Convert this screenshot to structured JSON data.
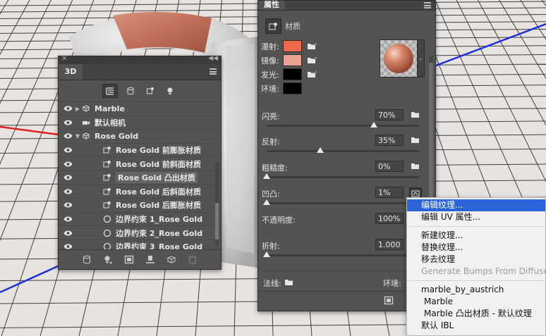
{
  "panel3d": {
    "tab": "3D",
    "filter_icons": [
      "scene-filter-icon",
      "mesh-filter-icon",
      "material-filter-icon",
      "light-filter-icon"
    ],
    "layers": [
      {
        "label": "Marble",
        "indent": 0,
        "expand": "▶",
        "icon": "mesh-icon",
        "bold": true,
        "selected": false
      },
      {
        "label": "默认相机",
        "indent": 0,
        "expand": "",
        "icon": "camera-icon",
        "bold": true,
        "selected": false
      },
      {
        "label": "Rose Gold",
        "indent": 0,
        "expand": "▼",
        "icon": "mesh-icon",
        "bold": true,
        "selected": false
      },
      {
        "label": "Rose Gold 前膨胀材质",
        "indent": 1,
        "expand": "",
        "icon": "material-icon",
        "bold": true,
        "selected": false
      },
      {
        "label": "Rose Gold 前斜面材质",
        "indent": 1,
        "expand": "",
        "icon": "material-icon",
        "bold": true,
        "selected": false
      },
      {
        "label": "Rose Gold 凸出材质",
        "indent": 1,
        "expand": "",
        "icon": "material-icon",
        "bold": true,
        "selected": true
      },
      {
        "label": "Rose Gold 后斜面材质",
        "indent": 1,
        "expand": "",
        "icon": "material-icon",
        "bold": true,
        "selected": false
      },
      {
        "label": "Rose Gold 后膨胀材质",
        "indent": 1,
        "expand": "",
        "icon": "material-icon",
        "bold": true,
        "selected": false
      },
      {
        "label": "边界约束 1_Rose Gold",
        "indent": 1,
        "expand": "",
        "icon": "constraint-icon",
        "bold": true,
        "selected": false
      },
      {
        "label": "边界约束 2_Rose Gold",
        "indent": 1,
        "expand": "",
        "icon": "constraint-icon",
        "bold": true,
        "selected": false
      },
      {
        "label": "边界约束 3_Rose Gold",
        "indent": 1,
        "expand": "",
        "icon": "constraint-icon",
        "bold": true,
        "selected": false
      }
    ],
    "bottom_icons": [
      "scene-db-icon",
      "add-light-icon",
      "render-icon",
      "ground-icon",
      "add-mesh-icon",
      "trash-icon"
    ]
  },
  "properties": {
    "tab": "属性",
    "type_label": "材质",
    "swatches": [
      {
        "label": "漫射:",
        "color": "#ee6a4b"
      },
      {
        "label": "镜像:",
        "color": "#e9a190"
      },
      {
        "label": "发光:",
        "color": "#000000"
      },
      {
        "label": "环境:",
        "color": "#000000"
      }
    ],
    "sliders": [
      {
        "label": "闪亮:",
        "value": "70%",
        "pos": 0.7
      },
      {
        "label": "反射:",
        "value": "35%",
        "pos": 0.35
      },
      {
        "label": "粗糙度:",
        "value": "0%",
        "pos": 0.0
      },
      {
        "label": "凹凸:",
        "value": "1%",
        "pos": 0.0
      },
      {
        "label": "不透明度:",
        "value": "100%",
        "pos": null
      },
      {
        "label": "折射:",
        "value": "1.000",
        "pos": 0.0
      }
    ],
    "normal_label": "法线:",
    "env_label": "环境:"
  },
  "context_menu": {
    "items": [
      {
        "label": "编辑纹理...",
        "state": "highlight"
      },
      {
        "label": "编辑 UV 属性...",
        "state": "normal"
      },
      {
        "sep": true
      },
      {
        "label": "新建纹理...",
        "state": "normal"
      },
      {
        "label": "替换纹理...",
        "state": "normal"
      },
      {
        "label": "移去纹理",
        "state": "normal"
      },
      {
        "label": "Generate Bumps From Diffuse",
        "state": "disabled"
      },
      {
        "sep": true
      },
      {
        "label": "marble_by_austrich",
        "state": "normal"
      },
      {
        "label": "Marble",
        "state": "sub"
      },
      {
        "label": "Marble 凸出材质 - 默认纹理",
        "state": "sub"
      },
      {
        "label": "默认 IBL",
        "state": "normal"
      }
    ]
  }
}
